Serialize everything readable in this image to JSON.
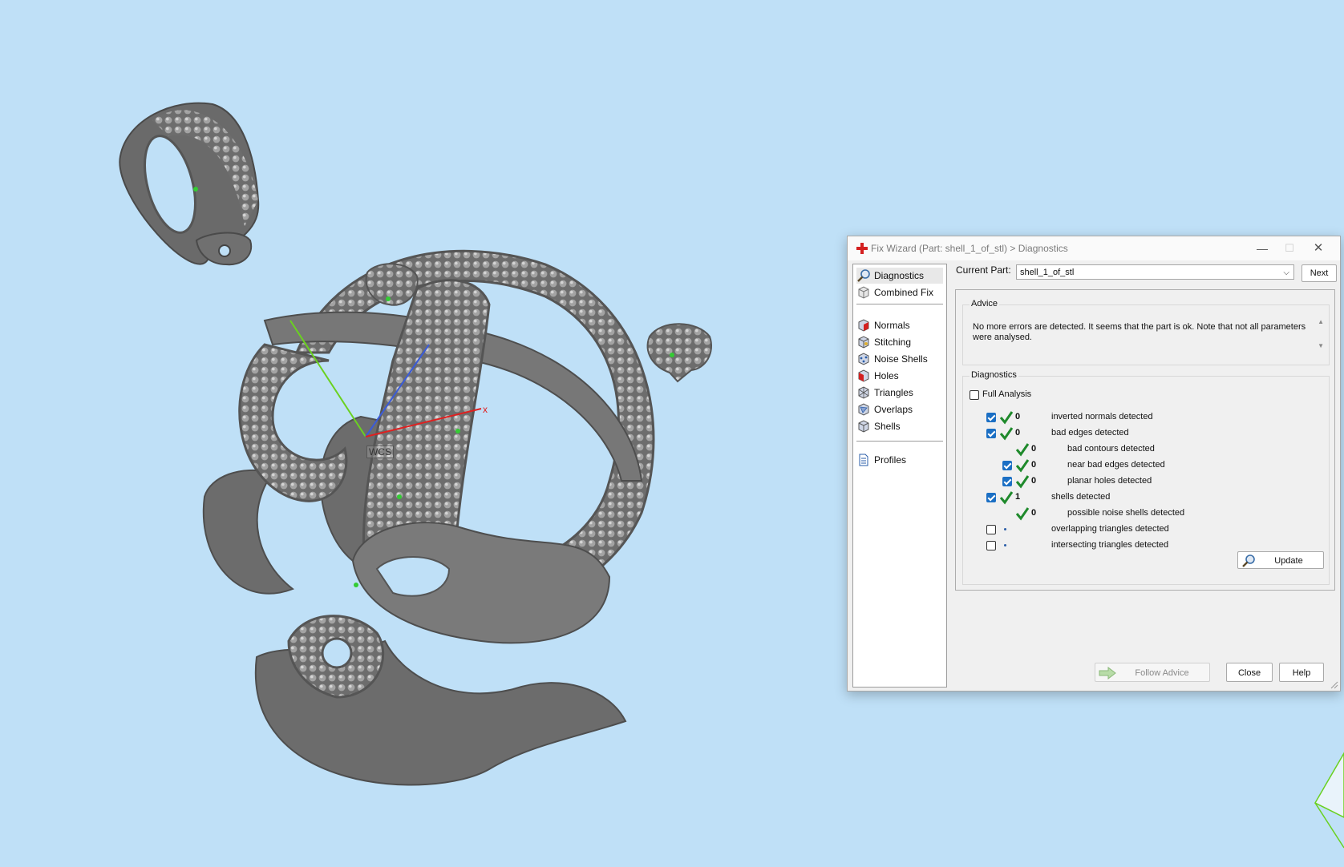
{
  "window": {
    "title": "Fix Wizard (Part: shell_1_of_stl) > Diagnostics",
    "minimize_glyph": "—",
    "maximize_glyph": "☐",
    "close_glyph": "✕"
  },
  "viewport": {
    "wcs_label": "WCS",
    "axis_x_label": "x",
    "axis_colors": {
      "x": "#e02020",
      "y": "#6ad120",
      "z": "#3a5bd8"
    },
    "background": "#bfe0f7",
    "model_color": "#6e6e6e"
  },
  "nav": {
    "items": [
      {
        "label": "Diagnostics",
        "icon": "magnifier-icon",
        "selected": true
      },
      {
        "label": "Combined Fix",
        "icon": "cube-icon"
      },
      {
        "label": "Normals",
        "icon": "normals-cube-icon"
      },
      {
        "label": "Stitching",
        "icon": "stitching-cube-icon"
      },
      {
        "label": "Noise Shells",
        "icon": "noise-shells-icon"
      },
      {
        "label": "Holes",
        "icon": "holes-cube-icon"
      },
      {
        "label": "Triangles",
        "icon": "triangles-icon"
      },
      {
        "label": "Overlaps",
        "icon": "overlaps-icon"
      },
      {
        "label": "Shells",
        "icon": "shells-icon"
      },
      {
        "label": "Profiles",
        "icon": "document-icon"
      }
    ]
  },
  "part": {
    "label": "Current Part:",
    "value": "shell_1_of_stl",
    "next_label": "Next"
  },
  "advice": {
    "title": "Advice",
    "text": "No more errors are detected. It seems that the part is ok. Note that not all parameters were analysed."
  },
  "diagnostics": {
    "title": "Diagnostics",
    "full_analysis_label": "Full Analysis",
    "rows": [
      {
        "count": "0",
        "label": "inverted normals detected"
      },
      {
        "count": "0",
        "label": "bad edges detected"
      },
      {
        "count": "0",
        "label": "bad contours detected"
      },
      {
        "count": "0",
        "label": "near bad edges detected"
      },
      {
        "count": "0",
        "label": "planar holes detected"
      },
      {
        "count": "1",
        "label": "shells detected"
      },
      {
        "count": "0",
        "label": "possible noise shells detected"
      },
      {
        "count": "",
        "label": "overlapping triangles detected"
      },
      {
        "count": "",
        "label": "intersecting triangles detected"
      }
    ],
    "update_label": "Update"
  },
  "footer": {
    "follow_label": "Follow Advice",
    "close_label": "Close",
    "help_label": "Help"
  },
  "colors": {
    "check_green": "#1f8a2c",
    "checkbox_blue": "#1b6fc4",
    "app_icon_red": "#d42020"
  }
}
